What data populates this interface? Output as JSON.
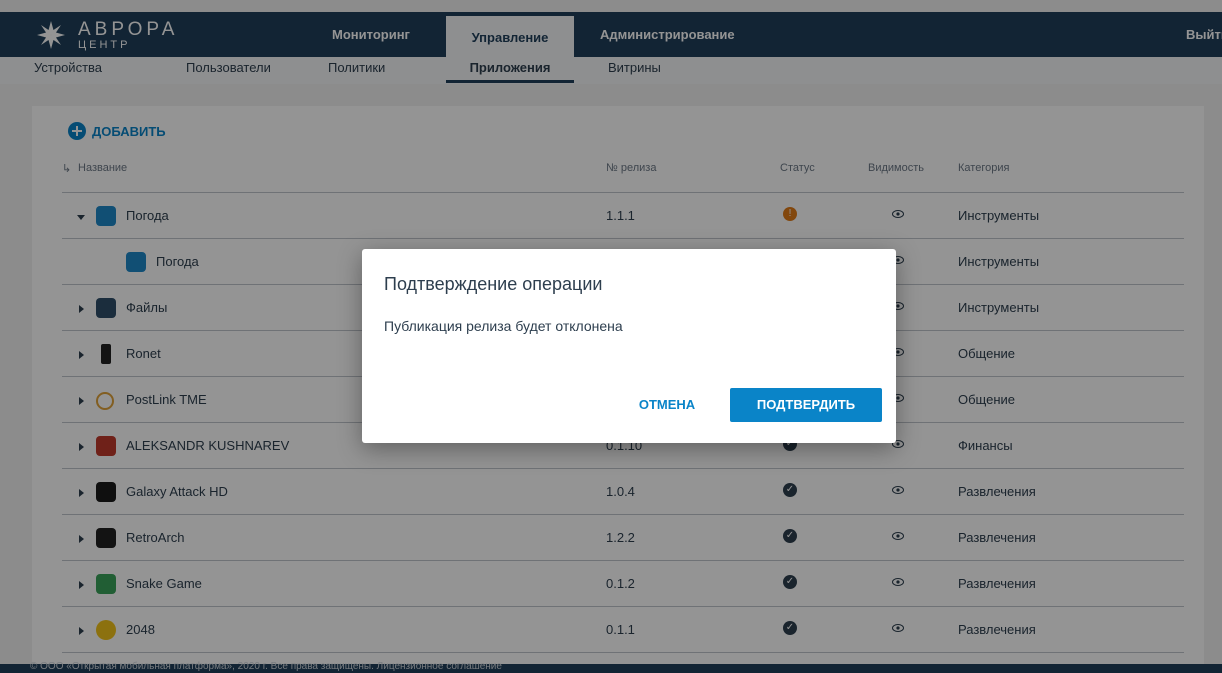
{
  "brand": {
    "line1": "АВРОРА",
    "line2": "ЦЕНТР"
  },
  "nav": {
    "items": [
      {
        "label": "Мониторинг"
      },
      {
        "label": "Управление"
      },
      {
        "label": "Администрирование"
      }
    ],
    "active": "Управление",
    "exit_label": "Выйти"
  },
  "subnav": {
    "items": [
      {
        "label": "Устройства"
      },
      {
        "label": "Пользователи"
      },
      {
        "label": "Политики"
      },
      {
        "label": "Приложения"
      },
      {
        "label": "Витрины"
      }
    ],
    "active": "Приложения"
  },
  "add_button": {
    "label": "ДОБАВИТЬ"
  },
  "table": {
    "headers": {
      "name": "Название",
      "release": "№ релиза",
      "status": "Статус",
      "visibility": "Видимость",
      "category": "Категория"
    },
    "rows": [
      {
        "name": "Погода",
        "release": "1.1.1",
        "status": "warning",
        "category": "Инструменты",
        "expanded": true,
        "icon": "weather-icon"
      },
      {
        "name": "Погода",
        "release": "",
        "status": "",
        "category": "Инструменты",
        "child": true,
        "icon": "weather-icon"
      },
      {
        "name": "Файлы",
        "release": "",
        "status": "",
        "category": "Инструменты",
        "icon": "files-icon"
      },
      {
        "name": "Ronet",
        "release": "",
        "status": "",
        "category": "Общение",
        "icon": "phone-icon"
      },
      {
        "name": "PostLink TME",
        "release": "",
        "status": "",
        "category": "Общение",
        "icon": "link-icon"
      },
      {
        "name": "ALEKSANDR KUSHNAREV",
        "release": "0.1.10",
        "status": "ok",
        "category": "Финансы",
        "icon": "user-app-icon"
      },
      {
        "name": "Galaxy Attack HD",
        "release": "1.0.4",
        "status": "ok",
        "category": "Развлечения",
        "icon": "game-icon"
      },
      {
        "name": "RetroArch",
        "release": "1.2.2",
        "status": "ok",
        "category": "Развлечения",
        "icon": "invader-icon"
      },
      {
        "name": "Snake Game",
        "release": "0.1.2",
        "status": "ok",
        "category": "Развлечения",
        "icon": "snake-icon"
      },
      {
        "name": "2048",
        "release": "0.1.1",
        "status": "ok",
        "category": "Развлечения",
        "icon": "2048-icon"
      }
    ]
  },
  "footer": {
    "text": "© ООО «Открытая мобильная платформа», 2020 г. Все права защищены. Лицензионное соглашение"
  },
  "dialog": {
    "title": "Подтверждение операции",
    "message": "Публикация релиза будет отклонена",
    "cancel_label": "ОТМЕНА",
    "confirm_label": "ПОДТВЕРДИТЬ"
  },
  "colors": {
    "header_bg": "#1f3f5a",
    "accent": "#0a84c8",
    "warning": "#e07b17",
    "ok": "#2d3e4e"
  }
}
